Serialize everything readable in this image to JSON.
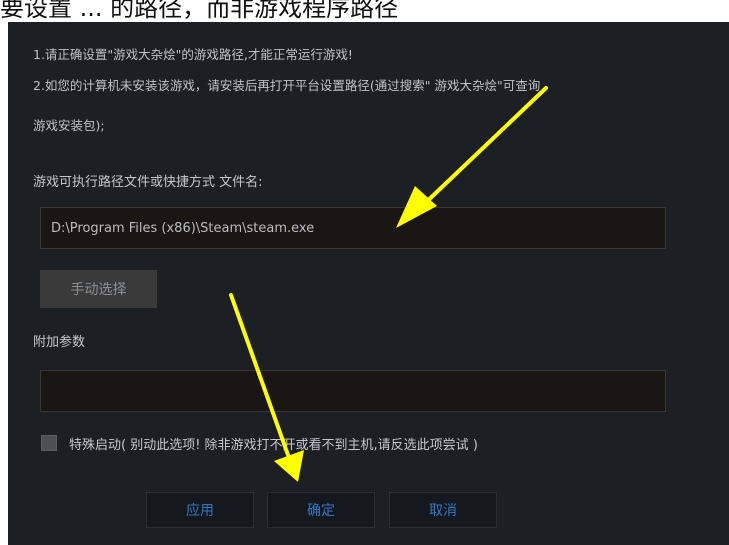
{
  "caption_fragment": "要设置 ... 的路径，而非游戏程序路径",
  "notices": [
    "1.请正确设置\"游戏大杂烩\"的游戏路径,才能正常运行游戏!",
    "2.如您的计算机未安装该游戏，请安装后再打开平台设置路径(通过搜索\" 游戏大杂烩\"可查询",
    "游戏安装包);"
  ],
  "exe_path": {
    "label": "游戏可执行路径文件或快捷方式 文件名:",
    "value": "D:\\Program Files (x86)\\Steam\\steam.exe"
  },
  "manual_select_label": "手动选择",
  "extra_params": {
    "label": "附加参数",
    "value": ""
  },
  "special_launch": {
    "checked": false,
    "label": "特殊启动( 别动此选项! 除非游戏打不开或看不到主机,请反选此项尝试 )"
  },
  "buttons": {
    "apply": "应用",
    "ok": "确定",
    "cancel": "取消"
  },
  "colors": {
    "dialog_bg": "#1c1f24",
    "accent_text": "#2e78c7",
    "annotation_arrow": "#ffff00"
  }
}
